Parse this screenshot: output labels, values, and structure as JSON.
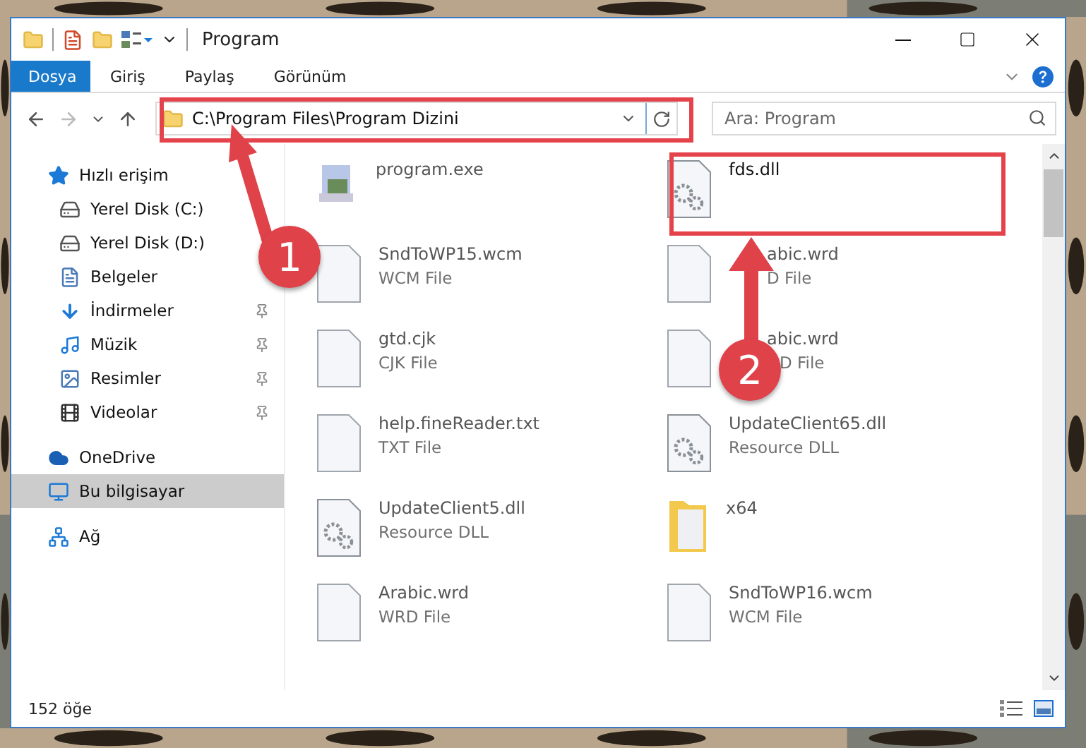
{
  "window": {
    "title": "Program"
  },
  "ribbon_tabs": [
    {
      "label": "Dosya",
      "selected": true
    },
    {
      "label": "Giriş",
      "selected": false
    },
    {
      "label": "Paylaş",
      "selected": false
    },
    {
      "label": "Görünüm",
      "selected": false
    }
  ],
  "address": "C:\\Program Files\\Program Dizini",
  "search": {
    "placeholder": "Ara: Program"
  },
  "sidebar": {
    "items": [
      {
        "label": "Hızlı erişim",
        "kind": "star",
        "selected": false,
        "children": [
          {
            "label": "Yerel Disk (C:)",
            "kind": "drive",
            "pinned": false,
            "selected": false
          },
          {
            "label": "Yerel Disk (D:)",
            "kind": "drive",
            "pinned": false,
            "selected": false
          },
          {
            "label": "Belgeler",
            "kind": "docs",
            "pinned": false,
            "selected": false
          },
          {
            "label": "İndirmeler",
            "kind": "download",
            "pinned": true,
            "selected": false
          },
          {
            "label": "Müzik",
            "kind": "music",
            "pinned": true,
            "selected": false
          },
          {
            "label": "Resimler",
            "kind": "pictures",
            "pinned": true,
            "selected": false
          },
          {
            "label": "Videolar",
            "kind": "videos",
            "pinned": true,
            "selected": false
          }
        ]
      },
      {
        "label": "OneDrive",
        "kind": "cloud",
        "selected": false
      },
      {
        "label": "Bu bilgisayar",
        "kind": "pc",
        "selected": true
      },
      {
        "label": "Ağ",
        "kind": "network",
        "selected": false
      }
    ]
  },
  "files": [
    {
      "name": "program.exe",
      "kind": "exe",
      "dim": true
    },
    {
      "name": "fds.dll",
      "kind": "dll",
      "dim": false
    },
    {
      "name": "SndToWP15.wcm",
      "type": "WCM File",
      "kind": "file",
      "dim": true
    },
    {
      "name": "abic.wrd",
      "type": "D File",
      "kind": "file",
      "dim": true,
      "under_arrow": true,
      "under_badge": false
    },
    {
      "name": "gtd.cjk",
      "type": "CJK File",
      "kind": "file",
      "dim": true
    },
    {
      "name": "abic.wrd",
      "type": "D File",
      "kind": "file",
      "dim": true,
      "under_arrow": true,
      "under_badge": true
    },
    {
      "name": "help.fineReader.txt",
      "type": "TXT File",
      "kind": "file",
      "dim": true
    },
    {
      "name": "UpdateClient65.dll",
      "type": "Resource DLL",
      "kind": "dll",
      "dim": true
    },
    {
      "name": "UpdateClient5.dll",
      "type": "Resource DLL",
      "kind": "dll",
      "dim": true
    },
    {
      "name": "x64",
      "kind": "folder",
      "dim": true
    },
    {
      "name": "Arabic.wrd",
      "type": "WRD File",
      "kind": "file",
      "dim": true
    },
    {
      "name": "SndToWP16.wcm",
      "type": "WCM File",
      "kind": "file",
      "dim": true
    }
  ],
  "annotations": [
    {
      "number": "1"
    },
    {
      "number": "2"
    }
  ],
  "status_bar": {
    "count": "152 öğe"
  }
}
